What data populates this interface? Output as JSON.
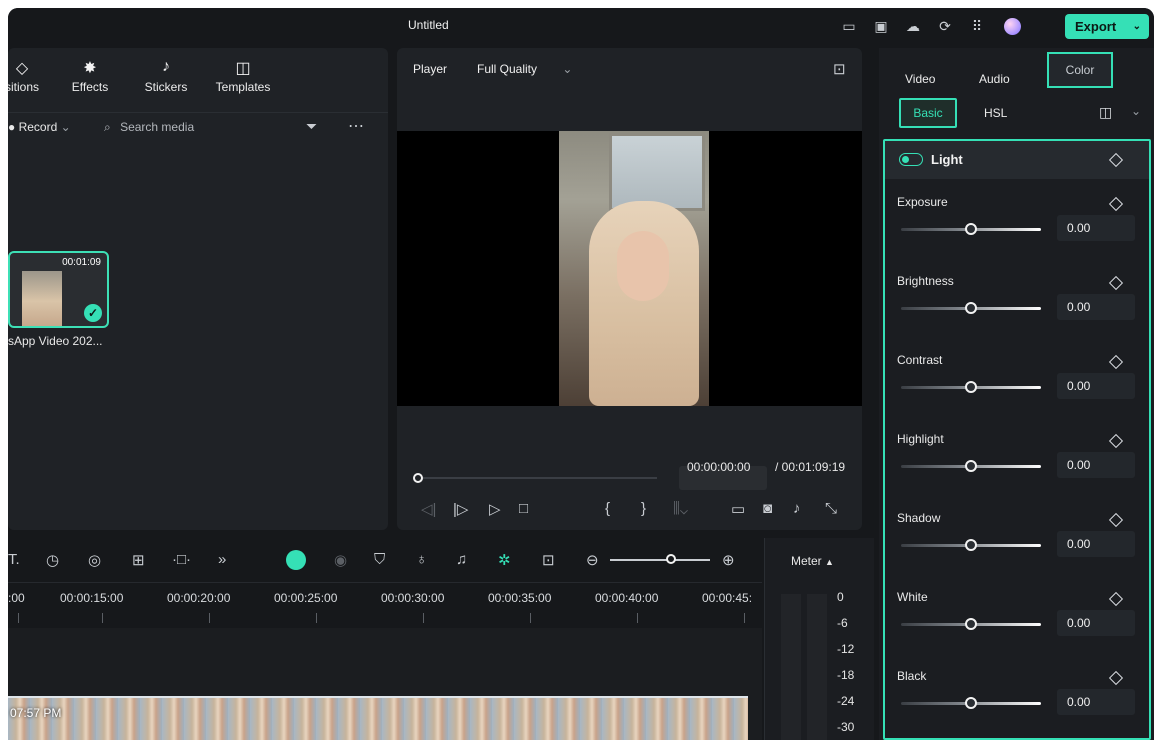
{
  "titlebar": {
    "title": "Untitled",
    "export_label": "Export"
  },
  "library": {
    "tabs": [
      {
        "label": "sitions",
        "icon": "transitions-icon"
      },
      {
        "label": "Effects",
        "icon": "effects-icon"
      },
      {
        "label": "Stickers",
        "icon": "stickers-icon"
      },
      {
        "label": "Templates",
        "icon": "templates-icon"
      }
    ],
    "record_label": "Record",
    "search_placeholder": "Search media",
    "media": [
      {
        "name": "sApp Video 202...",
        "duration": "00:01:09"
      }
    ]
  },
  "player": {
    "label": "Player",
    "quality": "Full Quality",
    "current_time": "00:00:00:00",
    "total_time": "/ 00:01:09:19"
  },
  "right_panel": {
    "tabs": [
      "Video",
      "Audio",
      "Color"
    ],
    "active_tab": "Color",
    "subtabs": [
      "Basic",
      "HSL"
    ],
    "active_subtab": "Basic",
    "section_title": "Light",
    "sliders": [
      {
        "label": "Exposure",
        "value": "0.00"
      },
      {
        "label": "Brightness",
        "value": "0.00"
      },
      {
        "label": "Contrast",
        "value": "0.00"
      },
      {
        "label": "Highlight",
        "value": "0.00"
      },
      {
        "label": "Shadow",
        "value": "0.00"
      },
      {
        "label": "White",
        "value": "0.00"
      },
      {
        "label": "Black",
        "value": "0.00"
      }
    ]
  },
  "timeline": {
    "ruler": [
      ":00",
      "00:00:15:00",
      "00:00:20:00",
      "00:00:25:00",
      "00:00:30:00",
      "00:00:35:00",
      "00:00:40:00",
      "00:00:45:"
    ],
    "clip_time": "07:57 PM"
  },
  "meter": {
    "label": "Meter",
    "scale": [
      "0",
      "-6",
      "-12",
      "-18",
      "-24",
      "-30"
    ]
  },
  "colors": {
    "accent": "#35e0b6",
    "background": "#16181b",
    "panel": "#1f2226"
  }
}
